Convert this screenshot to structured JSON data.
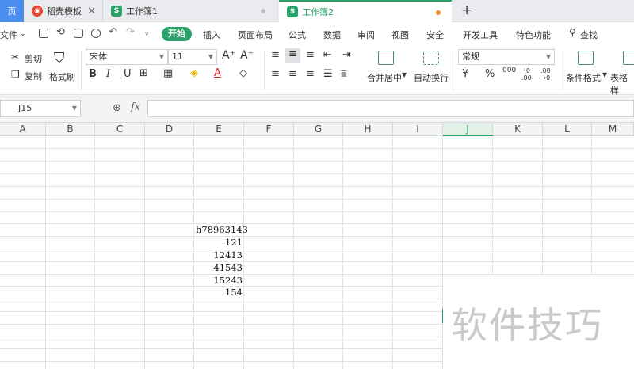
{
  "tabs": {
    "home": "页",
    "docer": "稻壳模板",
    "book1": "工作簿1",
    "book2": "工作簿2",
    "new_tab": "+"
  },
  "menu": {
    "file": "文件",
    "items": [
      "开始",
      "插入",
      "页面布局",
      "公式",
      "数据",
      "审阅",
      "视图",
      "安全",
      "开发工具",
      "特色功能"
    ],
    "search": "查找"
  },
  "ribbon": {
    "cut": "剪切",
    "copy": "复制",
    "format_painter": "格式刷",
    "font_name": "宋体",
    "font_size": "11",
    "merge_center": "合并居中",
    "wrap_text": "自动换行",
    "number_format": "常规",
    "conditional_format": "条件格式",
    "table_style": "表格样"
  },
  "formula_bar": {
    "cell_ref": "J15",
    "fx": "fx",
    "content": ""
  },
  "columns": [
    "A",
    "B",
    "C",
    "D",
    "E",
    "F",
    "G",
    "H",
    "I",
    "J",
    "K",
    "L",
    "M"
  ],
  "selected_column": "J",
  "cells": {
    "E8": "h78963143",
    "E9": "121",
    "E10": "12413",
    "E11": "41543",
    "E12": "15243",
    "E13": "154"
  },
  "watermark": "软件技巧",
  "colors": {
    "accent": "#2aa36b",
    "tab_bar": "#e9ebee",
    "modified_dot": "#f08a2a"
  }
}
